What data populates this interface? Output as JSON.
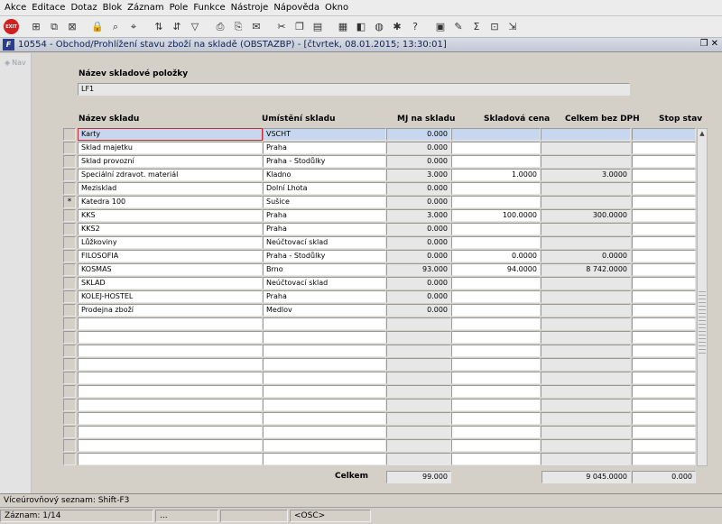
{
  "menu": [
    "Akce",
    "Editace",
    "Dotaz",
    "Blok",
    "Záznam",
    "Pole",
    "Funkce",
    "Nástroje",
    "Nápověda",
    "Okno"
  ],
  "window": {
    "title": "10554 - Obchod/Prohlížení stavu zboží na skladě (OBSTAZBP) - [čtvrtek, 08.01.2015; 13:30:01]",
    "app_icon": "F"
  },
  "nav": {
    "label": "Nav"
  },
  "toolbar": {
    "exit_label": "EXIT"
  },
  "form": {
    "item_label": "Název skladové položky",
    "item_value": "LF1"
  },
  "columns": {
    "name": "Název skladu",
    "location": "Umístění skladu",
    "qty": "MJ na skladu",
    "price": "Skladová cena",
    "total": "Celkem bez DPH",
    "stop": "Stop stav"
  },
  "rows": [
    {
      "marker": "",
      "name": "Karty",
      "location": "VSCHT",
      "qty": "0.000",
      "price": "",
      "total": "",
      "stop": ""
    },
    {
      "marker": "",
      "name": "Sklad majetku",
      "location": "Praha",
      "qty": "0.000",
      "price": "",
      "total": "",
      "stop": ""
    },
    {
      "marker": "",
      "name": "Sklad provozní",
      "location": "Praha - Stodůlky",
      "qty": "0.000",
      "price": "",
      "total": "",
      "stop": ""
    },
    {
      "marker": "",
      "name": "Speciální zdravot. materiál",
      "location": "Kladno",
      "qty": "3.000",
      "price": "1.0000",
      "total": "3.0000",
      "stop": ""
    },
    {
      "marker": "",
      "name": "Mezisklad",
      "location": "Dolní Lhota",
      "qty": "0.000",
      "price": "",
      "total": "",
      "stop": ""
    },
    {
      "marker": "*",
      "name": "Katedra 100",
      "location": "Sušice",
      "qty": "0.000",
      "price": "",
      "total": "",
      "stop": ""
    },
    {
      "marker": "",
      "name": "KKS",
      "location": "Praha",
      "qty": "3.000",
      "price": "100.0000",
      "total": "300.0000",
      "stop": ""
    },
    {
      "marker": "",
      "name": "KKS2",
      "location": "Praha",
      "qty": "0.000",
      "price": "",
      "total": "",
      "stop": ""
    },
    {
      "marker": "",
      "name": "Lůžkoviny",
      "location": "Neúčtovací sklad",
      "qty": "0.000",
      "price": "",
      "total": "",
      "stop": ""
    },
    {
      "marker": "",
      "name": "FILOSOFIA",
      "location": "Praha - Stodůlky",
      "qty": "0.000",
      "price": "0.0000",
      "total": "0.0000",
      "stop": ""
    },
    {
      "marker": "",
      "name": "KOSMAS",
      "location": "Brno",
      "qty": "93.000",
      "price": "94.0000",
      "total": "8 742.0000",
      "stop": ""
    },
    {
      "marker": "",
      "name": "SKLAD",
      "location": "Neúčtovací sklad",
      "qty": "0.000",
      "price": "",
      "total": "",
      "stop": ""
    },
    {
      "marker": "",
      "name": "KOLEJ-HOSTEL",
      "location": "Praha",
      "qty": "0.000",
      "price": "",
      "total": "",
      "stop": ""
    },
    {
      "marker": "",
      "name": "Prodejna zboží",
      "location": "Medlov",
      "qty": "0.000",
      "price": "",
      "total": "",
      "stop": ""
    },
    {
      "marker": "",
      "name": "",
      "location": "",
      "qty": "",
      "price": "",
      "total": "",
      "stop": ""
    },
    {
      "marker": "",
      "name": "",
      "location": "",
      "qty": "",
      "price": "",
      "total": "",
      "stop": ""
    },
    {
      "marker": "",
      "name": "",
      "location": "",
      "qty": "",
      "price": "",
      "total": "",
      "stop": ""
    },
    {
      "marker": "",
      "name": "",
      "location": "",
      "qty": "",
      "price": "",
      "total": "",
      "stop": ""
    },
    {
      "marker": "",
      "name": "",
      "location": "",
      "qty": "",
      "price": "",
      "total": "",
      "stop": ""
    },
    {
      "marker": "",
      "name": "",
      "location": "",
      "qty": "",
      "price": "",
      "total": "",
      "stop": ""
    },
    {
      "marker": "",
      "name": "",
      "location": "",
      "qty": "",
      "price": "",
      "total": "",
      "stop": ""
    },
    {
      "marker": "",
      "name": "",
      "location": "",
      "qty": "",
      "price": "",
      "total": "",
      "stop": ""
    },
    {
      "marker": "",
      "name": "",
      "location": "",
      "qty": "",
      "price": "",
      "total": "",
      "stop": ""
    },
    {
      "marker": "",
      "name": "",
      "location": "",
      "qty": "",
      "price": "",
      "total": "",
      "stop": ""
    },
    {
      "marker": "",
      "name": "",
      "location": "",
      "qty": "",
      "price": "",
      "total": "",
      "stop": ""
    }
  ],
  "totals": {
    "label": "Celkem",
    "qty": "99.000",
    "total": "9 045.0000",
    "stop": "0.000"
  },
  "status": {
    "hint": "Víceúrovňový seznam: Shift-F3",
    "record": "Záznam: 1/14",
    "seg2": "...",
    "seg3": "",
    "mode": "<OSC>"
  },
  "colors": {
    "selected_row": "#c6d7ef",
    "active_cell_border": "#c03030",
    "readonly_cell": "#e7e7e7"
  }
}
